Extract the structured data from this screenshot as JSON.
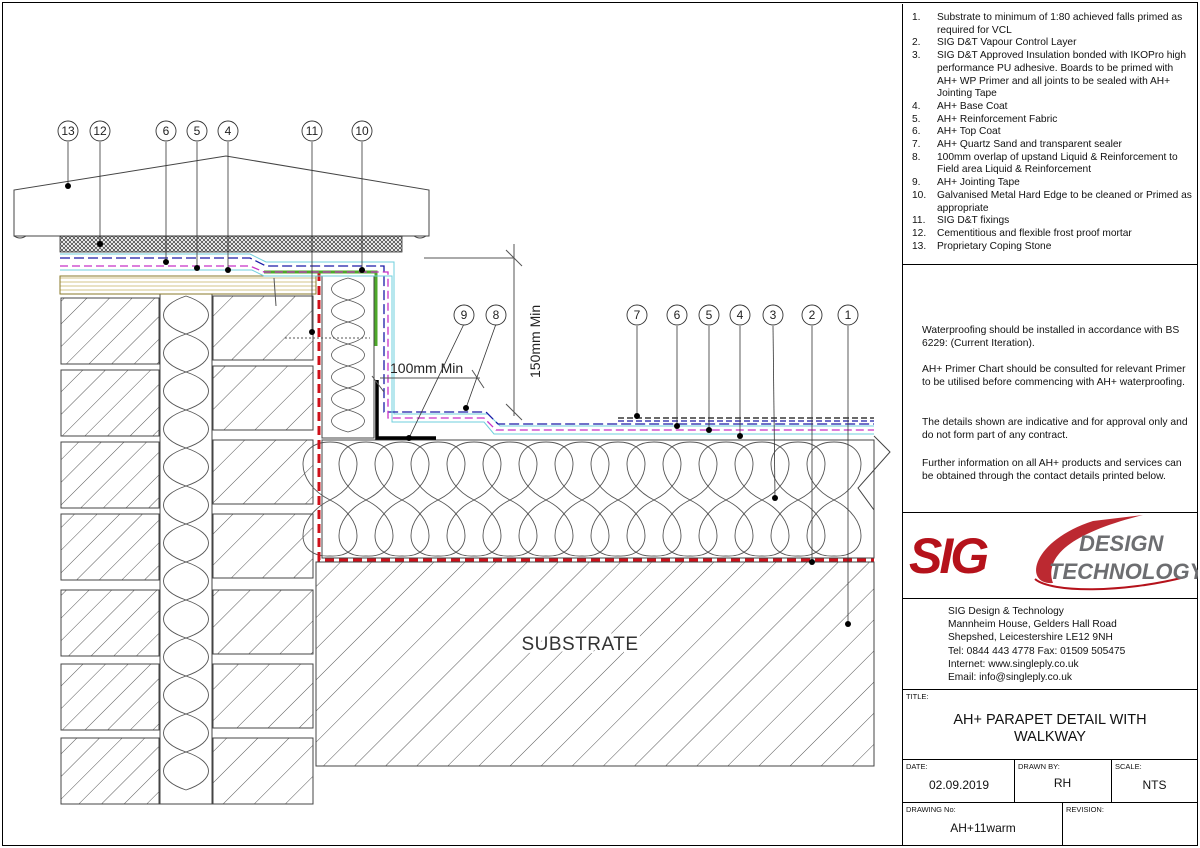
{
  "notes": [
    {
      "num": "1.",
      "text": "Substrate to minimum of 1:80 achieved falls primed as required for VCL"
    },
    {
      "num": "2.",
      "text": "SIG D&T Vapour Control Layer"
    },
    {
      "num": "3.",
      "text": "SIG D&T Approved Insulation bonded with IKOPro high performance PU adhesive. Boards to be primed with AH+ WP Primer and all joints to be sealed with AH+ Jointing Tape"
    },
    {
      "num": "4.",
      "text": "AH+ Base Coat"
    },
    {
      "num": "5.",
      "text": "AH+ Reinforcement Fabric"
    },
    {
      "num": "6.",
      "text": "AH+ Top Coat"
    },
    {
      "num": "7.",
      "text": "AH+ Quartz Sand and transparent sealer"
    },
    {
      "num": "8.",
      "text": "100mm overlap of upstand Liquid & Reinforcement to Field area Liquid & Reinforcement"
    },
    {
      "num": "9.",
      "text": "AH+ Jointing Tape"
    },
    {
      "num": "10.",
      "text": "Galvanised Metal Hard Edge to be cleaned or Primed as appropriate"
    },
    {
      "num": "11.",
      "text": "SIG D&T fixings"
    },
    {
      "num": "12.",
      "text": "Cementitious and flexible frost proof mortar"
    },
    {
      "num": "13.",
      "text": "Proprietary Coping Stone"
    }
  ],
  "paragraphs": [
    "Waterproofing should be installed in accordance with BS 6229: (Current Iteration).",
    "AH+ Primer Chart should be consulted for relevant Primer to be utilised before commencing with AH+ waterproofing.",
    "The details shown are indicative and for approval only and do not form part of any contract.",
    "Further information on all AH+ products and services  can be obtained through the contact details printed below."
  ],
  "logo": {
    "mark": "SIG",
    "line1": "DESIGN",
    "line2": "TECHNOLOGY",
    "red": "#b5121b",
    "grey": "#6d6e71"
  },
  "contact": {
    "company": "SIG Design & Technology",
    "address1": "Mannheim House, Gelders Hall Road",
    "address2": "Shepshed, Leicestershire LE12 9NH",
    "phone": "Tel: 0844 443 4778 Fax: 01509 505475",
    "internet": "Internet: www.singleply.co.uk",
    "email": "Email: info@singleply.co.uk"
  },
  "titleblock": {
    "title_label": "TITLE:",
    "title_line1": "AH+ PARAPET DETAIL WITH",
    "title_line2": "WALKWAY",
    "date_label": "DATE:",
    "date": "02.09.2019",
    "drawn_label": "DRAWN BY:",
    "drawn": "RH",
    "scale_label": "SCALE:",
    "scale": "NTS",
    "drawing_no_label": "DRAWING No:",
    "drawing_no": "AH+11warm",
    "revision_label": "REVISION:",
    "revision": ""
  },
  "drawing": {
    "substrate_label": "SUBSTRATE",
    "dim_100": "100mm Min",
    "dim_150": "150mm Min",
    "callouts_left": [
      "13",
      "12",
      "6",
      "5",
      "4",
      "11",
      "10"
    ],
    "callouts_mid": [
      "9",
      "8"
    ],
    "callouts_right": [
      "7",
      "6",
      "5",
      "4",
      "3",
      "2",
      "1"
    ],
    "colors": {
      "vcl": "#d0101a",
      "topcoat": "#1a1aa8",
      "fabric": "#c832c8",
      "basecoat": "#6fcfdc",
      "hardedge": "#4ea82a"
    }
  }
}
